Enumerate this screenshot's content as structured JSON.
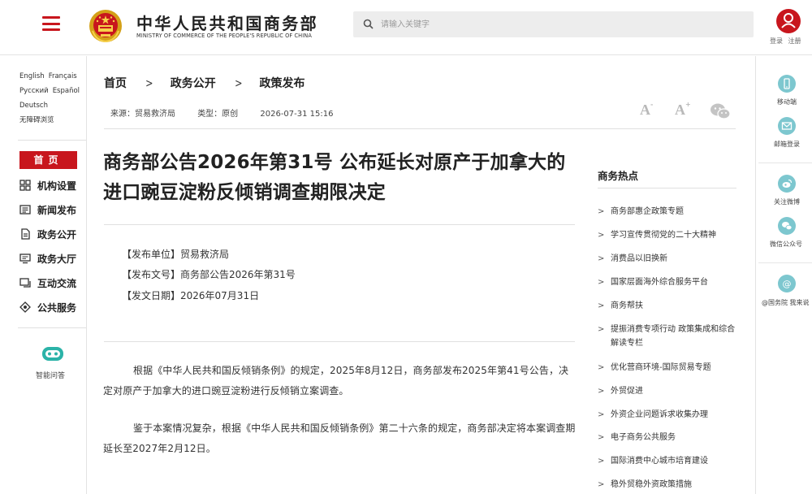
{
  "header": {
    "logo_cn": "中华人民共和国商务部",
    "logo_en": "MINISTRY OF COMMERCE OF THE PEOPLE'S REPUBLIC OF CHINA",
    "search_placeholder": "请输入关键字",
    "login_label": "登录",
    "register_label": "注册"
  },
  "languages": [
    "English",
    "Français",
    "Русский",
    "Español",
    "Deutsch",
    "无障碍浏览"
  ],
  "left_nav": {
    "home_label": "首页",
    "items": [
      "机构设置",
      "新闻发布",
      "政务公开",
      "政务大厅",
      "互动交流",
      "公共服务"
    ],
    "assistant_label": "智能问答"
  },
  "breadcrumb": [
    "首页",
    "政务公开",
    "政策发布"
  ],
  "breadcrumb_sep": ">",
  "meta": {
    "source": "来源：贸易救济局",
    "type": "类型：原创",
    "datetime": "2026-07-31 15:16"
  },
  "font_controls": {
    "small_label": "A",
    "small_sign": "-",
    "large_label": "A",
    "large_sign": "+"
  },
  "article": {
    "title": "商务部公告2026年第31号 公布延长对原产于加拿大的进口豌豆淀粉反倾销调查期限决定",
    "issuer": "【发布单位】贸易救济局",
    "doc_no": "【发布文号】商务部公告2026年第31号",
    "issue_date": "【发文日期】2026年07月31日",
    "paragraphs": [
      "根据《中华人民共和国反倾销条例》的规定，2025年8月12日，商务部发布2025年第41号公告，决定对原产于加拿大的进口豌豆淀粉进行反倾销立案调查。",
      "鉴于本案情况复杂，根据《中华人民共和国反倾销条例》第二十六条的规定，商务部决定将本案调查期延长至2027年2月12日。"
    ]
  },
  "hot": {
    "title": "商务热点",
    "arrow": ">",
    "items": [
      "商务部惠企政策专题",
      "学习宣传贯彻党的二十大精神",
      "消费品以旧换新",
      "国家层面海外综合服务平台",
      "商务帮扶",
      "提振消费专项行动 政策集成和综合解读专栏",
      "优化营商环境-国际贸易专题",
      "外贸促进",
      "外资企业问题诉求收集办理",
      "电子商务公共服务",
      "国际消费中心城市培育建设",
      "稳外贸稳外资政策措施"
    ]
  },
  "right_sidebar": {
    "mobile": "移动端",
    "email": "邮箱登录",
    "weibo": "关注微博",
    "wechat": "微信公众号",
    "gwy": "@国务院 我来说"
  },
  "colors": {
    "brand_red": "#c8161d",
    "teal": "#7dc7cf",
    "search_bg": "#ededed"
  }
}
